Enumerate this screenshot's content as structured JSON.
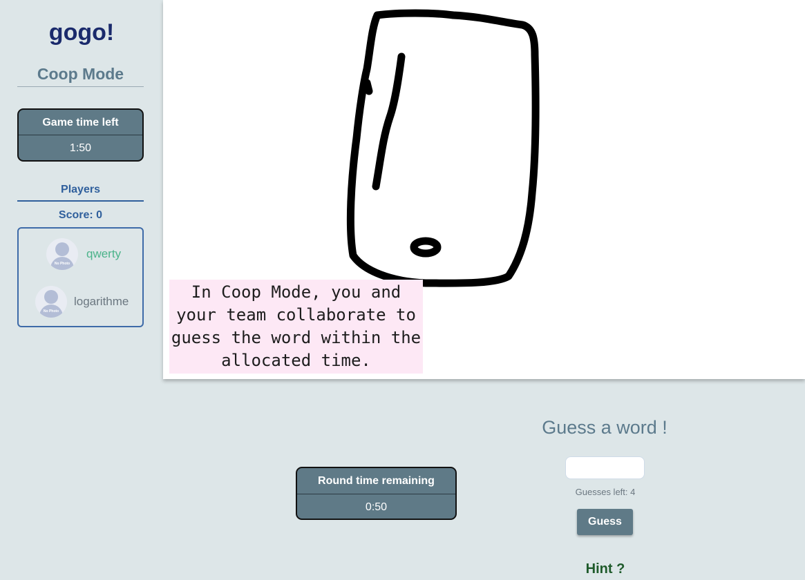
{
  "sidebar": {
    "logo": "gogo!",
    "mode": "Coop Mode",
    "game_timer": {
      "label": "Game time left",
      "value": "1:50"
    },
    "players_title": "Players",
    "score": "Score: 0",
    "players": [
      {
        "name": "qwerty",
        "avatar_text": "No Photo"
      },
      {
        "name": "logarithme",
        "avatar_text": "No Photo"
      }
    ]
  },
  "canvas": {
    "info": "In Coop Mode, you and your team collaborate to guess the word within the allocated time."
  },
  "round_timer": {
    "label": "Round time remaining",
    "value": "0:50"
  },
  "guess": {
    "title": "Guess a word !",
    "input_value": "",
    "guesses_left": "Guesses left: 4",
    "button": "Guess",
    "hint": "Hint ?"
  },
  "colors": {
    "background": "#dde6e8",
    "accent": "#5f7a87",
    "logo": "#1a2a6c",
    "player_online": "#4bb38a",
    "info_bg": "#fde8f5"
  }
}
